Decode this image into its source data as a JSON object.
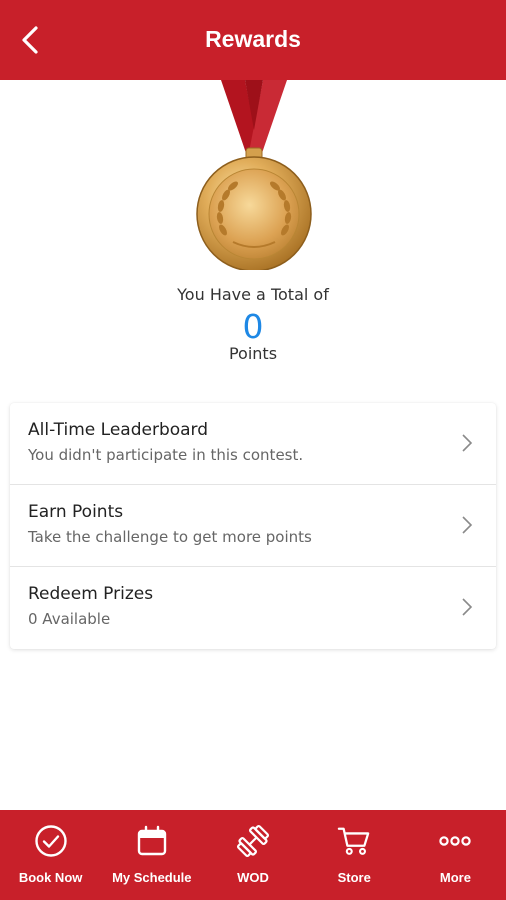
{
  "header": {
    "title": "Rewards"
  },
  "points": {
    "total_label": "You Have a Total of",
    "value": "0",
    "unit_label": "Points"
  },
  "menu": [
    {
      "title": "All-Time Leaderboard",
      "subtitle": "You didn't participate in this contest."
    },
    {
      "title": "Earn Points",
      "subtitle": "Take the challenge to get more points"
    },
    {
      "title": "Redeem Prizes",
      "subtitle": "0 Available"
    }
  ],
  "bottom_nav": [
    {
      "label": "Book Now",
      "icon": "check-circle-icon"
    },
    {
      "label": "My Schedule",
      "icon": "calendar-icon"
    },
    {
      "label": "WOD",
      "icon": "dumbbell-icon"
    },
    {
      "label": "Store",
      "icon": "cart-icon"
    },
    {
      "label": "More",
      "icon": "more-dots-icon"
    }
  ],
  "colors": {
    "brand_red": "#c8202a",
    "points_blue": "#1e88e5",
    "medal_gold": "#d9a24a"
  }
}
